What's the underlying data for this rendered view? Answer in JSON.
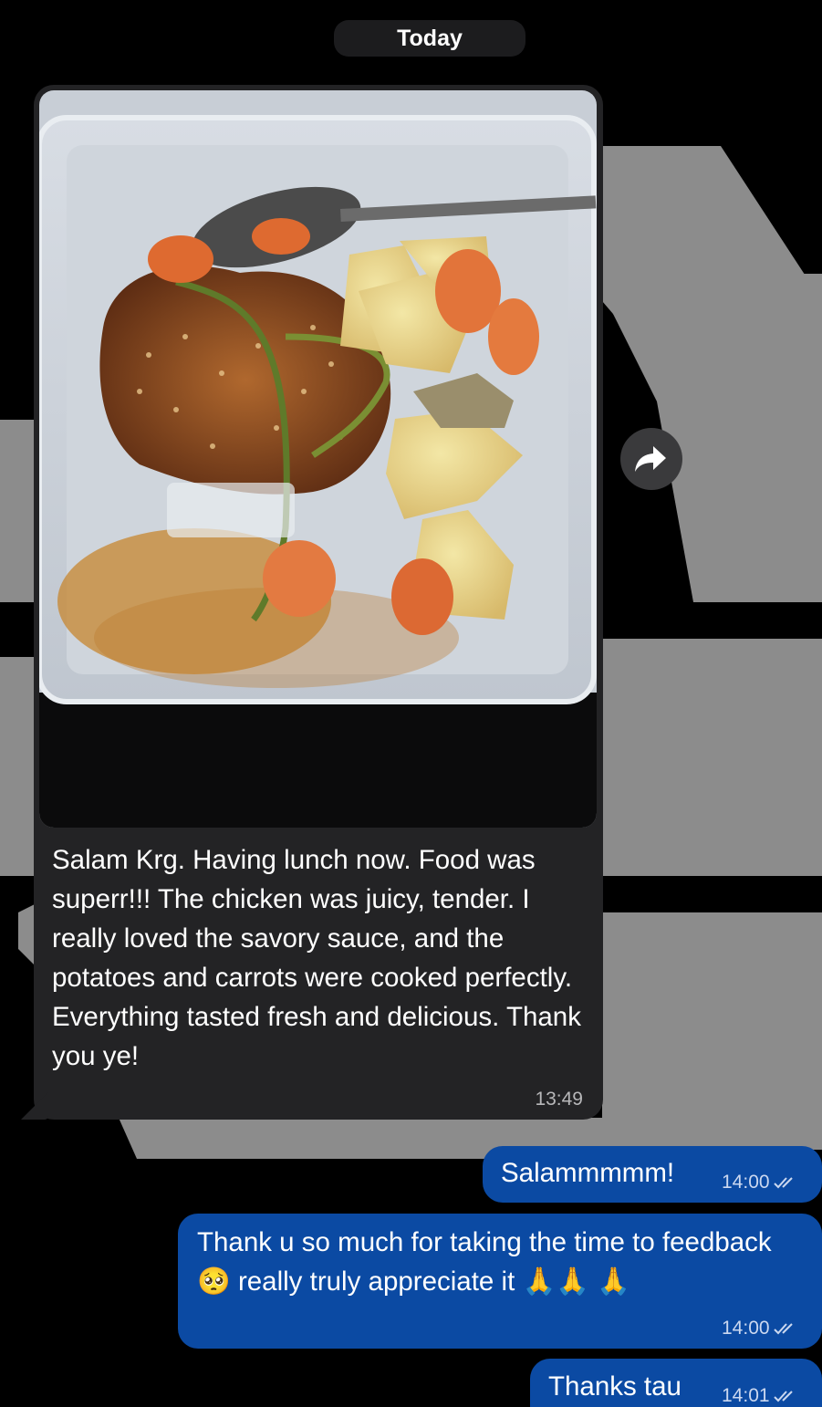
{
  "date_separator": "Today",
  "messages": [
    {
      "direction": "incoming",
      "has_photo": true,
      "text": "Salam Krg. Having lunch now. Food was superr!!! The chicken was juicy, tender. I really loved the savory sauce, and the potatoes and carrots were cooked perfectly. Everything tasted fresh and delicious. Thank you ye!",
      "time": "13:49"
    },
    {
      "direction": "outgoing",
      "text": "Salammmmm!",
      "time": "14:00"
    },
    {
      "direction": "outgoing",
      "text_part1": "Thank u so much for taking the time to feedback",
      "emoji1": "🥺",
      "text_part2": "really truly appreciate it",
      "emoji2": "🙏🙏",
      "emoji3": "🙏",
      "time": "14:00"
    },
    {
      "direction": "outgoing",
      "text": "Thanks tau",
      "time": "14:01"
    }
  ],
  "icons": {
    "forward": "forward-arrow-icon",
    "read_receipt": "double-check-icon"
  },
  "colors": {
    "background": "#000000",
    "incoming_bubble": "#232325",
    "outgoing_bubble": "#0b4aa3",
    "wallpaper_logo": "#8c8c8c"
  }
}
